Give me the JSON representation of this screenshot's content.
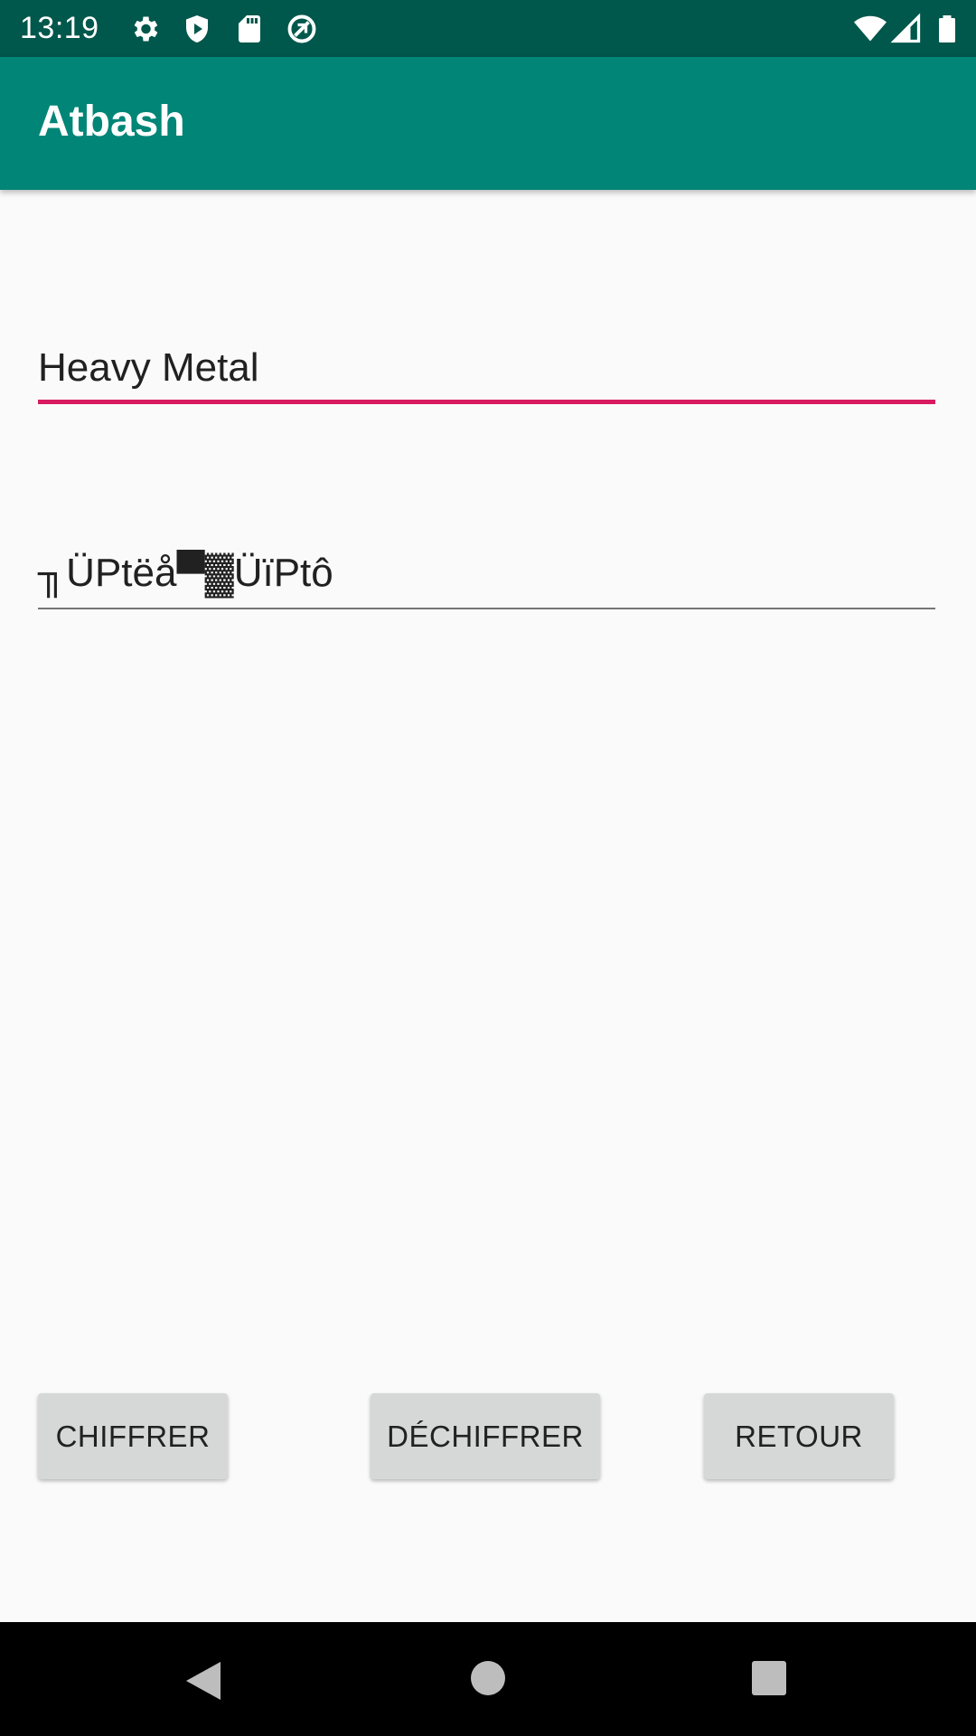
{
  "status_bar": {
    "time": "13:19",
    "icons": [
      "gear-icon",
      "shield-icon",
      "sd-card-icon",
      "no-sync-icon",
      "wifi-icon",
      "signal-icon",
      "battery-icon"
    ]
  },
  "app_bar": {
    "title": "Atbash"
  },
  "main": {
    "input_value": "Heavy Metal",
    "output_value": "╖ÜPtëå▀▓ÜïPtô"
  },
  "buttons": {
    "encrypt_label": "CHIFFRER",
    "decrypt_label": "DÉCHIFFRER",
    "back_label": "RETOUR"
  },
  "nav_bar": {
    "icons": [
      "back-icon",
      "home-icon",
      "recents-icon"
    ]
  },
  "colors": {
    "status_bar": "#00574b",
    "app_bar": "#008577",
    "accent": "#d81b60",
    "background": "#fafafa",
    "button": "#d6d7d7"
  }
}
